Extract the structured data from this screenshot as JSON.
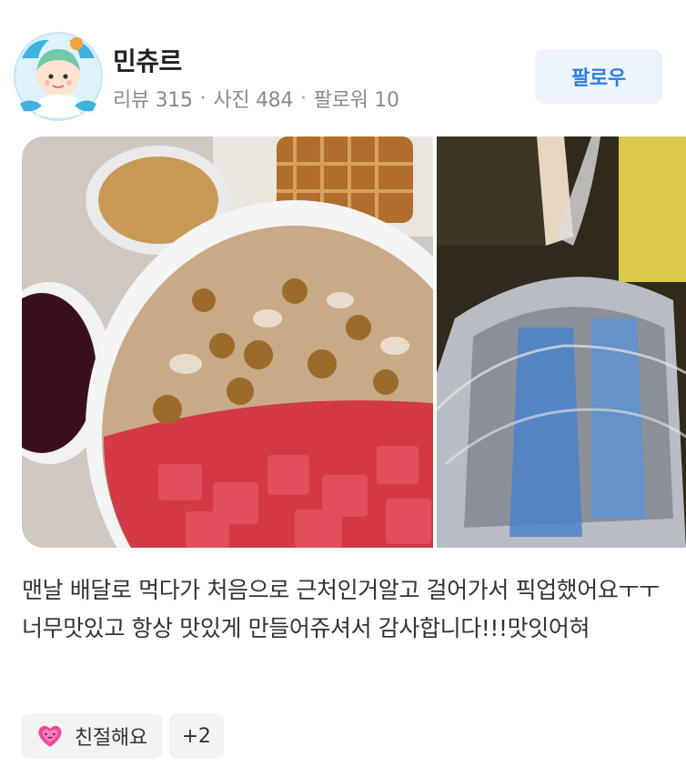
{
  "user": {
    "name": "민츄르",
    "stats": [
      {
        "label": "리뷰 315"
      },
      {
        "label": "사진 484"
      },
      {
        "label": "팔로워 10"
      }
    ],
    "follow_label": "팔로우"
  },
  "review": {
    "text": "맨날 배달로 먹다가 처음으로 근처인거알고 걸어가서 픽업했어요ㅜㅜ너무맛있고 항상 맛있게 만들어쥬셔서 감사합니다!!!맛잇어혀"
  },
  "photos": [
    {
      "label": "injeolmi-bingsu-photo"
    },
    {
      "label": "takeout-bag-photo"
    }
  ],
  "tags": {
    "primary": {
      "label": "친절해요",
      "icon": "heart-emoji-icon"
    },
    "more": "+2"
  },
  "colors": {
    "accent": "#2f7de1",
    "follow_bg": "#eef4fb",
    "tag_bg": "#f3f3f3"
  }
}
